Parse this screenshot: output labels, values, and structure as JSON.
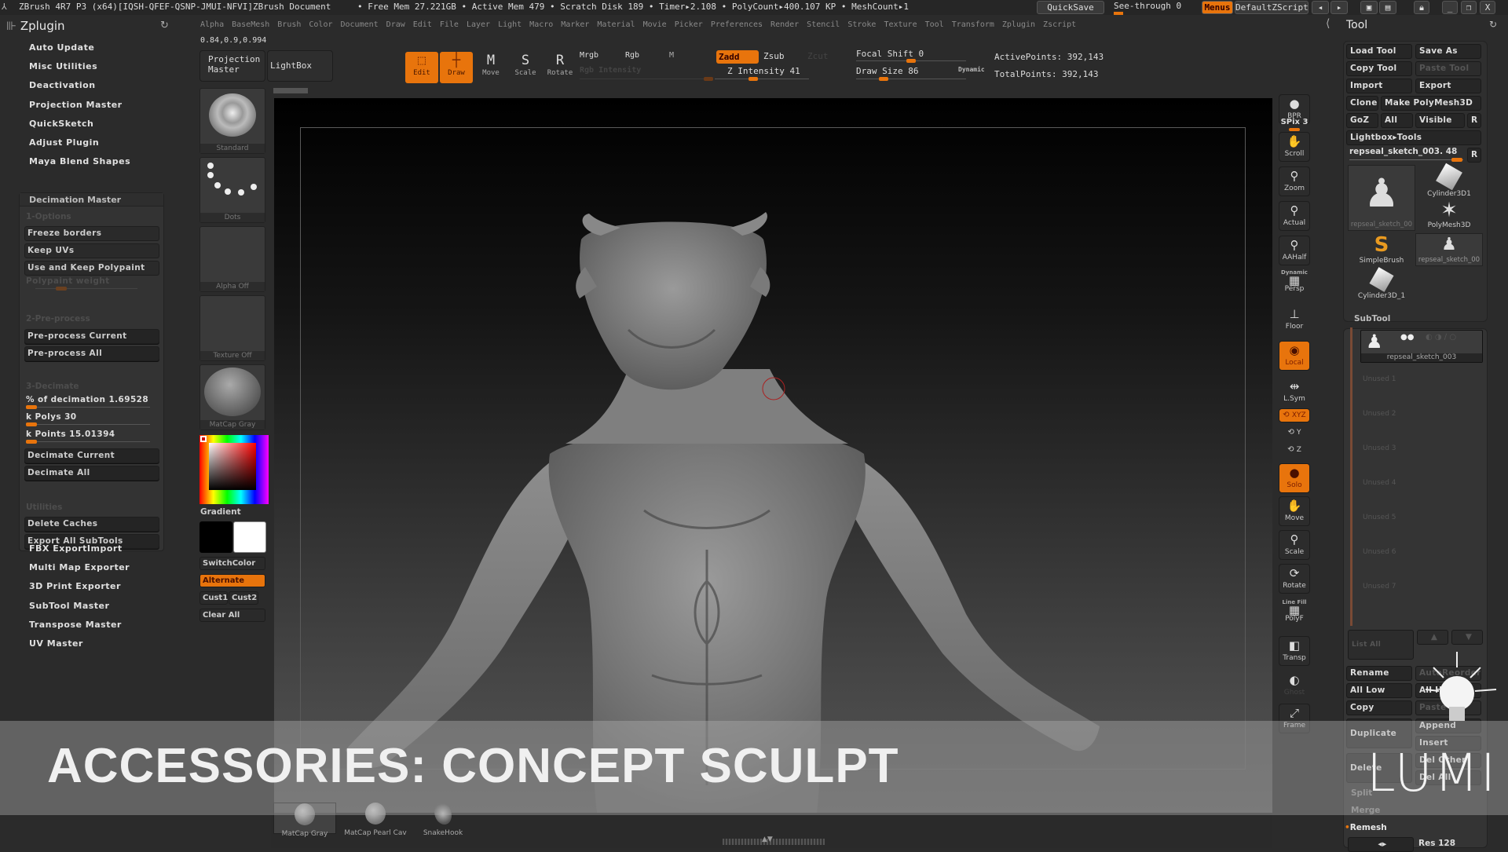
{
  "titlebar": {
    "app": "ZBrush 4R7 P3 (x64)[IQSH-QFEF-QSNP-JMUI-NFVI]",
    "document": "ZBrush Document",
    "stats": "• Free Mem 27.221GB • Active Mem 479 • Scratch Disk 189 •  Timer▸2.108 • PolyCount▸400.107 KP  • MeshCount▸1",
    "quicksave": "QuickSave",
    "see_through": "See-through  0",
    "menus": "Menus",
    "script": "DefaultZScript"
  },
  "menubar": [
    "Alpha",
    "BaseMesh",
    "Brush",
    "Color",
    "Document",
    "Draw",
    "Edit",
    "File",
    "Layer",
    "Light",
    "Macro",
    "Marker",
    "Material",
    "Movie",
    "Picker",
    "Preferences",
    "Render",
    "Stencil",
    "Stroke",
    "Texture",
    "Tool",
    "Transform",
    "Zplugin",
    "Zscript"
  ],
  "shelf": {
    "color_readout": "0.84,0.9,0.994",
    "projection_master": "Projection Master",
    "lightbox": "LightBox",
    "modes": [
      {
        "label": "Edit",
        "icon": "edit-icon",
        "active": true
      },
      {
        "label": "Draw",
        "icon": "draw-icon",
        "active": true
      },
      {
        "label": "Move",
        "icon": "move-icon",
        "active": false
      },
      {
        "label": "Scale",
        "icon": "scale-icon",
        "active": false
      },
      {
        "label": "Rotate",
        "icon": "rotate-icon",
        "active": false
      }
    ],
    "mrgb": "Mrgb",
    "rgb": "Rgb",
    "m": "M",
    "rgb_intensity": "Rgb Intensity",
    "zadd": "Zadd",
    "zsub": "Zsub",
    "zcut": "Zcut",
    "z_intensity": {
      "label": "Z Intensity 41",
      "value": 41,
      "fraction": 0.41
    },
    "focal_shift": {
      "label": "Focal Shift 0",
      "value": 0,
      "fraction": 0.5
    },
    "draw_size": {
      "label": "Draw Size 86",
      "value": 86,
      "fraction": 0.25
    },
    "dynamic": "Dynamic",
    "active_points": "ActivePoints: 392,143",
    "total_points": "TotalPoints: 392,143"
  },
  "leftpanel": {
    "title": "Zplugin",
    "items_top": [
      "Auto Update",
      "Misc Utilities",
      "Deactivation",
      "Projection Master",
      "QuickSketch",
      "Adjust Plugin",
      "Maya Blend Shapes"
    ],
    "decimation": {
      "title": "Decimation Master",
      "options_label": "1-Options",
      "freeze_borders": "Freeze borders",
      "keep_uvs": "Keep UVs",
      "keep_polypaint": "Use and Keep Polypaint",
      "polypaint_weight": "Polypaint weight",
      "preprocess_label": "2-Pre-process",
      "preprocess_current": "Pre-process Current",
      "preprocess_all": "Pre-process All",
      "decimate_label": "3-Decimate",
      "percent": "% of decimation 1.69528",
      "k_polys": "k Polys 30",
      "k_points": "k Points 15.01394",
      "decimate_current": "Decimate Current",
      "decimate_all": "Decimate All",
      "utilities_label": "Utilities",
      "delete_caches": "Delete Caches",
      "export_all": "Export All SubTools"
    },
    "items_bottom": [
      "FBX ExportImport",
      "Multi Map Exporter",
      "3D Print Exporter",
      "SubTool Master",
      "Transpose Master",
      "UV Master"
    ]
  },
  "toolcol": {
    "brush": "Standard",
    "stroke": "Dots",
    "alpha": "Alpha  Off",
    "texture": "Texture  Off",
    "material": "MatCap  Gray",
    "gradient": "Gradient",
    "switchcolor": "SwitchColor",
    "alternate": "Alternate",
    "cust1": "Cust1",
    "cust2": "Cust2",
    "clear_all": "Clear  All",
    "main_color": "#000000",
    "secondary_color": "#ffffff"
  },
  "rshelf": [
    {
      "label": "BPR",
      "icon": "bpr-icon"
    },
    {
      "label": "SPix 3",
      "icon": "",
      "slider": true
    },
    {
      "label": "Scroll",
      "icon": "hand-icon"
    },
    {
      "label": "Zoom",
      "icon": "zoom-icon"
    },
    {
      "label": "Actual",
      "icon": "actual-icon"
    },
    {
      "label": "AAHalf",
      "icon": "aahalf-icon"
    },
    {
      "label": "Persp",
      "icon": "perspective-icon",
      "top": "Dynamic"
    },
    {
      "label": "Floor",
      "icon": "floor-icon"
    },
    {
      "label": "Local",
      "icon": "local-icon",
      "active": true
    },
    {
      "label": "L.Sym",
      "icon": "lsym-icon"
    },
    {
      "label": "XYZ",
      "icon": "rotate-xyz-icon",
      "active": true,
      "small": true
    },
    {
      "label": "Y",
      "icon": "rotate-y-icon",
      "small": true
    },
    {
      "label": "Z",
      "icon": "rotate-z-icon",
      "small": true
    },
    {
      "label": "Solo",
      "icon": "solo-icon",
      "active": true
    },
    {
      "label": "Move",
      "icon": "move-icon"
    },
    {
      "label": "Scale",
      "icon": "scale-icon"
    },
    {
      "label": "Rotate",
      "icon": "rotate-icon"
    },
    {
      "label": "PolyF",
      "icon": "polyframe-icon",
      "top": "Line Fill"
    },
    {
      "label": "Transp",
      "icon": "transparency-icon"
    },
    {
      "label": "Ghost",
      "icon": "ghost-icon",
      "disabled": true
    },
    {
      "label": "Frame",
      "icon": "frame-icon"
    }
  ],
  "toolpanel": {
    "title": "Tool",
    "load_tool": "Load Tool",
    "save_as": "Save As",
    "copy_tool": "Copy Tool",
    "paste_tool": "Paste Tool",
    "import": "Import",
    "export": "Export",
    "clone": "Clone",
    "make_polymesh": "Make PolyMesh3D",
    "goz": "GoZ",
    "all": "All",
    "visible": "Visible",
    "r": "R",
    "lightbox_tools": "Lightbox▸Tools",
    "current_tool": "repseal_sketch_003. 48",
    "thumbs": [
      "repseal_sketch_00",
      "Cylinder3D1",
      "PolyMesh3D",
      "SimpleBrush",
      "repseal_sketch_00",
      "Cylinder3D_1"
    ],
    "subtool_title": "SubTool",
    "subtool_item": "repseal_sketch_003",
    "unused": [
      "Unused  1",
      "Unused  2",
      "Unused  3",
      "Unused  4",
      "Unused  5",
      "Unused  6",
      "Unused  7"
    ],
    "list_all": "List  All",
    "rename": "Rename",
    "auto_reorder": "AutoReorder",
    "all_low": "All  Low",
    "all_high": "All  High",
    "copy": "Copy",
    "paste": "Paste",
    "duplicate": "Duplicate",
    "append": "Append",
    "insert": "Insert",
    "delete": "Delete",
    "del_other": "Del Other",
    "del_all": "Del All",
    "split": "Split",
    "merge": "Merge",
    "remesh": "Remesh",
    "res": "Res 128"
  },
  "bottom_materials": [
    "MatCap  Gray",
    "MatCap  Pearl  Cav",
    "SnakeHook"
  ],
  "banner": {
    "title": "ACCESSORIES: CONCEPT SCULPT",
    "logo": "LUMI"
  },
  "colors": {
    "accent": "#e8740c",
    "background": "#2b2b2b"
  }
}
